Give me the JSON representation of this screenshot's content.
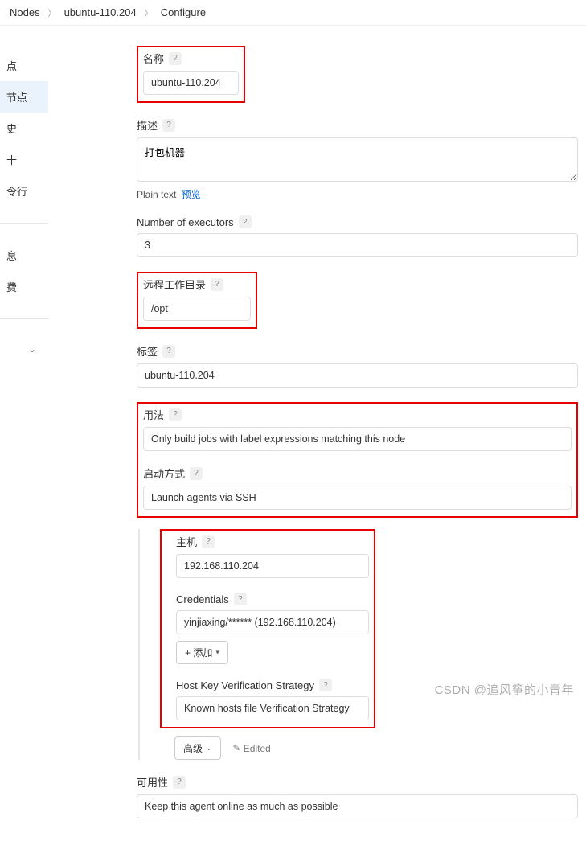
{
  "breadcrumb": {
    "nodes": "Nodes",
    "node": "ubuntu-110.204",
    "page": "Configure"
  },
  "sidebar": {
    "items": [
      "点",
      "节点",
      "史",
      "十",
      "令行"
    ],
    "items2": [
      "息",
      "费"
    ]
  },
  "form": {
    "name_label": "名称",
    "name_value": "ubuntu-110.204",
    "desc_label": "描述",
    "desc_value": "打包机器",
    "plain_text": "Plain text",
    "preview": "预览",
    "executors_label": "Number of executors",
    "executors_value": "3",
    "remote_label": "远程工作目录",
    "remote_value": "/opt",
    "labels_label": "标签",
    "labels_value": "ubuntu-110.204",
    "usage_label": "用法",
    "usage_value": "Only build jobs with label expressions matching this node",
    "launch_label": "启动方式",
    "launch_value": "Launch agents via SSH",
    "host_label": "主机",
    "host_value": "192.168.110.204",
    "cred_label": "Credentials",
    "cred_value": "yinjiaxing/****** (192.168.110.204)",
    "add_btn": "+ 添加",
    "hostkey_label": "Host Key Verification Strategy",
    "hostkey_value": "Known hosts file Verification Strategy",
    "advanced_btn": "高级",
    "edited": "Edited",
    "avail_label": "可用性",
    "avail_value": "Keep this agent online as much as possible"
  },
  "watermark": "CSDN @追风筝的小青年"
}
